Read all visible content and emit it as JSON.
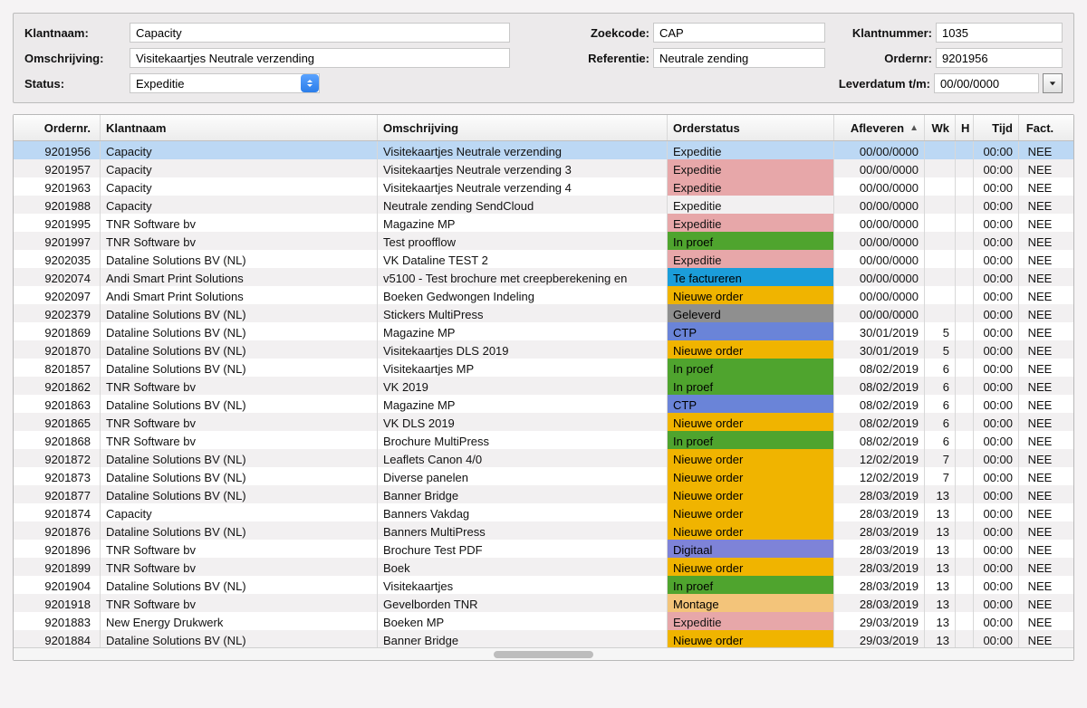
{
  "filter": {
    "labels": {
      "klantnaam": "Klantnaam:",
      "zoekcode": "Zoekcode:",
      "klantnummer": "Klantnummer:",
      "omschrijving": "Omschrijving:",
      "referentie": "Referentie:",
      "ordernr": "Ordernr:",
      "status": "Status:",
      "leverdatum": "Leverdatum t/m:"
    },
    "values": {
      "klantnaam": "Capacity",
      "zoekcode": "CAP",
      "klantnummer": "1035",
      "omschrijving": "Visitekaartjes Neutrale verzending",
      "referentie": "Neutrale zending",
      "ordernr": "9201956",
      "status": "Expeditie",
      "leverdatum": "00/00/0000"
    }
  },
  "columns": {
    "ordernr": "Ordernr.",
    "klantnaam": "Klantnaam",
    "omschrijving": "Omschrijving",
    "orderstatus": "Orderstatus",
    "afleveren": "Afleveren",
    "wk": "Wk",
    "h": "H",
    "tijd": "Tijd",
    "fact": "Fact."
  },
  "status_styles": {
    "Expeditie_plain": "st-exp-plain",
    "Expeditie_pink": "st-exp-pink",
    "In proef": "st-inproef",
    "Te factureren": "st-factureren",
    "Nieuwe order": "st-nieuwe",
    "Geleverd": "st-geleverd",
    "CTP": "st-ctp",
    "Digitaal": "st-digitaal",
    "Montage": "st-montage"
  },
  "rows": [
    {
      "sel": true,
      "ordernr": "9201956",
      "klant": "Capacity",
      "omsch": "Visitekaartjes Neutrale verzending",
      "status": "Expeditie",
      "stclass": "st-exp-plain",
      "aflev": "00/00/0000",
      "wk": "",
      "h": "",
      "tijd": "00:00",
      "fact": "NEE"
    },
    {
      "ordernr": "9201957",
      "klant": "Capacity",
      "omsch": "Visitekaartjes Neutrale verzending 3",
      "status": "Expeditie",
      "stclass": "st-exp-pink",
      "aflev": "00/00/0000",
      "wk": "",
      "h": "",
      "tijd": "00:00",
      "fact": "NEE"
    },
    {
      "ordernr": "9201963",
      "klant": "Capacity",
      "omsch": "Visitekaartjes Neutrale verzending 4",
      "status": "Expeditie",
      "stclass": "st-exp-pink",
      "aflev": "00/00/0000",
      "wk": "",
      "h": "",
      "tijd": "00:00",
      "fact": "NEE"
    },
    {
      "ordernr": "9201988",
      "klant": "Capacity",
      "omsch": "Neutrale zending SendCloud",
      "status": "Expeditie",
      "stclass": "st-exp-plain",
      "aflev": "00/00/0000",
      "wk": "",
      "h": "",
      "tijd": "00:00",
      "fact": "NEE"
    },
    {
      "ordernr": "9201995",
      "klant": "TNR Software bv",
      "omsch": "Magazine MP",
      "status": "Expeditie",
      "stclass": "st-exp-pink",
      "aflev": "00/00/0000",
      "wk": "",
      "h": "",
      "tijd": "00:00",
      "fact": "NEE"
    },
    {
      "ordernr": "9201997",
      "klant": "TNR Software bv",
      "omsch": "Test proofflow",
      "status": "In proef",
      "stclass": "st-inproef",
      "aflev": "00/00/0000",
      "wk": "",
      "h": "",
      "tijd": "00:00",
      "fact": "NEE"
    },
    {
      "ordernr": "9202035",
      "klant": "Dataline Solutions BV (NL)",
      "omsch": "VK Dataline TEST 2",
      "status": "Expeditie",
      "stclass": "st-exp-pink",
      "aflev": "00/00/0000",
      "wk": "",
      "h": "",
      "tijd": "00:00",
      "fact": "NEE"
    },
    {
      "ordernr": "9202074",
      "klant": "Andi Smart Print Solutions",
      "omsch": "v5100 - Test brochure met creepberekening en",
      "status": "Te factureren",
      "stclass": "st-factureren",
      "aflev": "00/00/0000",
      "wk": "",
      "h": "",
      "tijd": "00:00",
      "fact": "NEE"
    },
    {
      "ordernr": "9202097",
      "klant": "Andi Smart Print Solutions",
      "omsch": "Boeken Gedwongen Indeling",
      "status": "Nieuwe order",
      "stclass": "st-nieuwe",
      "aflev": "00/00/0000",
      "wk": "",
      "h": "",
      "tijd": "00:00",
      "fact": "NEE"
    },
    {
      "ordernr": "9202379",
      "klant": "Dataline Solutions BV (NL)",
      "omsch": "Stickers MultiPress",
      "status": "Geleverd",
      "stclass": "st-geleverd",
      "aflev": "00/00/0000",
      "wk": "",
      "h": "",
      "tijd": "00:00",
      "fact": "NEE"
    },
    {
      "ordernr": "9201869",
      "klant": "Dataline Solutions BV (NL)",
      "omsch": "Magazine MP",
      "status": "CTP",
      "stclass": "st-ctp",
      "aflev": "30/01/2019",
      "wk": "5",
      "h": "",
      "tijd": "00:00",
      "fact": "NEE"
    },
    {
      "ordernr": "9201870",
      "klant": "Dataline Solutions BV (NL)",
      "omsch": "Visitekaartjes DLS 2019",
      "status": "Nieuwe order",
      "stclass": "st-nieuwe",
      "aflev": "30/01/2019",
      "wk": "5",
      "h": "",
      "tijd": "00:00",
      "fact": "NEE"
    },
    {
      "ordernr": "8201857",
      "klant": "Dataline Solutions BV (NL)",
      "omsch": "Visitekaartjes MP",
      "status": "In proef",
      "stclass": "st-inproef",
      "aflev": "08/02/2019",
      "wk": "6",
      "h": "",
      "tijd": "00:00",
      "fact": "NEE"
    },
    {
      "ordernr": "9201862",
      "klant": "TNR Software bv",
      "omsch": "VK 2019",
      "status": "In proef",
      "stclass": "st-inproef",
      "aflev": "08/02/2019",
      "wk": "6",
      "h": "",
      "tijd": "00:00",
      "fact": "NEE"
    },
    {
      "ordernr": "9201863",
      "klant": "Dataline Solutions BV (NL)",
      "omsch": "Magazine MP",
      "status": "CTP",
      "stclass": "st-ctp",
      "aflev": "08/02/2019",
      "wk": "6",
      "h": "",
      "tijd": "00:00",
      "fact": "NEE"
    },
    {
      "ordernr": "9201865",
      "klant": "TNR Software bv",
      "omsch": "VK DLS 2019",
      "status": "Nieuwe order",
      "stclass": "st-nieuwe",
      "aflev": "08/02/2019",
      "wk": "6",
      "h": "",
      "tijd": "00:00",
      "fact": "NEE"
    },
    {
      "ordernr": "9201868",
      "klant": "TNR Software bv",
      "omsch": "Brochure MultiPress",
      "status": "In proef",
      "stclass": "st-inproef",
      "aflev": "08/02/2019",
      "wk": "6",
      "h": "",
      "tijd": "00:00",
      "fact": "NEE"
    },
    {
      "ordernr": "9201872",
      "klant": "Dataline Solutions BV (NL)",
      "omsch": "Leaflets Canon 4/0",
      "status": "Nieuwe order",
      "stclass": "st-nieuwe",
      "aflev": "12/02/2019",
      "wk": "7",
      "h": "",
      "tijd": "00:00",
      "fact": "NEE"
    },
    {
      "ordernr": "9201873",
      "klant": "Dataline Solutions BV (NL)",
      "omsch": "Diverse panelen",
      "status": "Nieuwe order",
      "stclass": "st-nieuwe",
      "aflev": "12/02/2019",
      "wk": "7",
      "h": "",
      "tijd": "00:00",
      "fact": "NEE"
    },
    {
      "ordernr": "9201877",
      "klant": "Dataline Solutions BV (NL)",
      "omsch": "Banner Bridge",
      "status": "Nieuwe order",
      "stclass": "st-nieuwe",
      "aflev": "28/03/2019",
      "wk": "13",
      "h": "",
      "tijd": "00:00",
      "fact": "NEE"
    },
    {
      "ordernr": "9201874",
      "klant": "Capacity",
      "omsch": "Banners Vakdag",
      "status": "Nieuwe order",
      "stclass": "st-nieuwe",
      "aflev": "28/03/2019",
      "wk": "13",
      "h": "",
      "tijd": "00:00",
      "fact": "NEE"
    },
    {
      "ordernr": "9201876",
      "klant": "Dataline Solutions BV (NL)",
      "omsch": "Banners MultiPress",
      "status": "Nieuwe order",
      "stclass": "st-nieuwe",
      "aflev": "28/03/2019",
      "wk": "13",
      "h": "",
      "tijd": "00:00",
      "fact": "NEE"
    },
    {
      "ordernr": "9201896",
      "klant": "TNR Software bv",
      "omsch": "Brochure Test PDF",
      "status": "Digitaal",
      "stclass": "st-digitaal",
      "aflev": "28/03/2019",
      "wk": "13",
      "h": "",
      "tijd": "00:00",
      "fact": "NEE"
    },
    {
      "ordernr": "9201899",
      "klant": "TNR Software bv",
      "omsch": "Boek",
      "status": "Nieuwe order",
      "stclass": "st-nieuwe",
      "aflev": "28/03/2019",
      "wk": "13",
      "h": "",
      "tijd": "00:00",
      "fact": "NEE"
    },
    {
      "ordernr": "9201904",
      "klant": "Dataline Solutions BV (NL)",
      "omsch": "Visitekaartjes",
      "status": "In proef",
      "stclass": "st-inproef",
      "aflev": "28/03/2019",
      "wk": "13",
      "h": "",
      "tijd": "00:00",
      "fact": "NEE"
    },
    {
      "ordernr": "9201918",
      "klant": "TNR Software bv",
      "omsch": "Gevelborden TNR",
      "status": "Montage",
      "stclass": "st-montage",
      "aflev": "28/03/2019",
      "wk": "13",
      "h": "",
      "tijd": "00:00",
      "fact": "NEE"
    },
    {
      "ordernr": "9201883",
      "klant": "New Energy Drukwerk",
      "omsch": "Boeken MP",
      "status": "Expeditie",
      "stclass": "st-exp-pink",
      "aflev": "29/03/2019",
      "wk": "13",
      "h": "",
      "tijd": "00:00",
      "fact": "NEE"
    },
    {
      "ordernr": "9201884",
      "klant": "Dataline Solutions BV (NL)",
      "omsch": "Banner Bridge",
      "status": "Nieuwe order",
      "stclass": "st-nieuwe",
      "aflev": "29/03/2019",
      "wk": "13",
      "h": "",
      "tijd": "00:00",
      "fact": "NEE"
    }
  ]
}
